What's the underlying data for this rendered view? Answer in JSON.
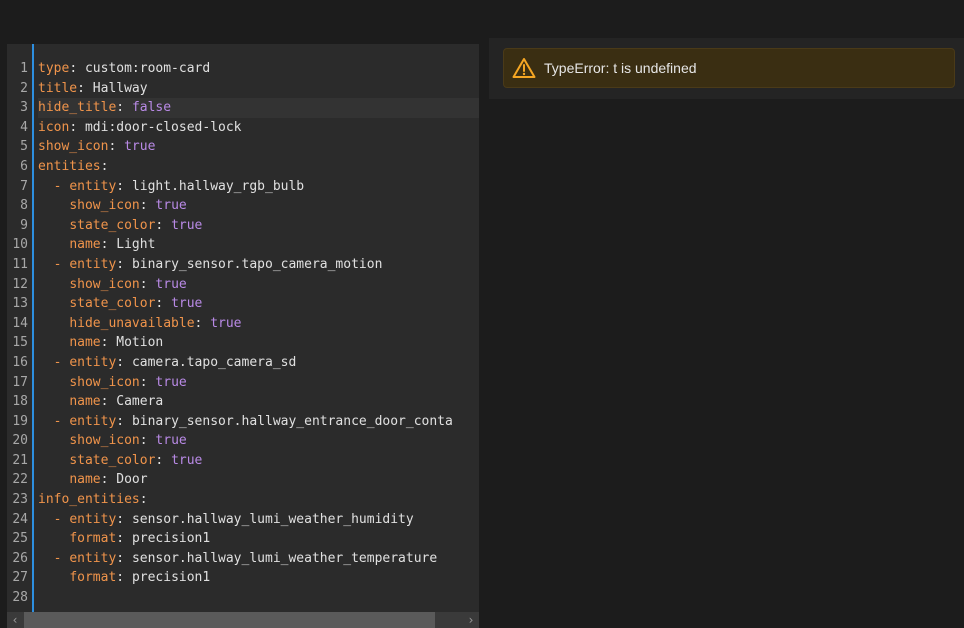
{
  "colors": {
    "accent": "#2d8fe0",
    "key": "#f0944b",
    "boolean": "#b98ae6",
    "warning": "#f5a623"
  },
  "editor": {
    "lines": [
      {
        "num": "1",
        "key": "type",
        "value": "custom:room-card"
      },
      {
        "num": "2",
        "key": "title",
        "value": "Hallway"
      },
      {
        "num": "3",
        "key": "hide_title",
        "value": "false",
        "bool": true,
        "active": true
      },
      {
        "num": "4",
        "key": "icon",
        "value": "mdi:door-closed-lock"
      },
      {
        "num": "5",
        "key": "show_icon",
        "value": "true",
        "bool": true
      },
      {
        "num": "6",
        "key": "entities",
        "value": ""
      },
      {
        "num": "7",
        "indent": "  ",
        "dash": true,
        "key": "entity",
        "value": "light.hallway_rgb_bulb"
      },
      {
        "num": "8",
        "indent": "    ",
        "key": "show_icon",
        "value": "true",
        "bool": true
      },
      {
        "num": "9",
        "indent": "    ",
        "key": "state_color",
        "value": "true",
        "bool": true
      },
      {
        "num": "10",
        "indent": "    ",
        "key": "name",
        "value": "Light"
      },
      {
        "num": "11",
        "indent": "  ",
        "dash": true,
        "key": "entity",
        "value": "binary_sensor.tapo_camera_motion"
      },
      {
        "num": "12",
        "indent": "    ",
        "key": "show_icon",
        "value": "true",
        "bool": true
      },
      {
        "num": "13",
        "indent": "    ",
        "key": "state_color",
        "value": "true",
        "bool": true
      },
      {
        "num": "14",
        "indent": "    ",
        "key": "hide_unavailable",
        "value": "true",
        "bool": true
      },
      {
        "num": "15",
        "indent": "    ",
        "key": "name",
        "value": "Motion"
      },
      {
        "num": "16",
        "indent": "  ",
        "dash": true,
        "key": "entity",
        "value": "camera.tapo_camera_sd"
      },
      {
        "num": "17",
        "indent": "    ",
        "key": "show_icon",
        "value": "true",
        "bool": true
      },
      {
        "num": "18",
        "indent": "    ",
        "key": "name",
        "value": "Camera"
      },
      {
        "num": "19",
        "indent": "  ",
        "dash": true,
        "key": "entity",
        "value": "binary_sensor.hallway_entrance_door_conta"
      },
      {
        "num": "20",
        "indent": "    ",
        "key": "show_icon",
        "value": "true",
        "bool": true
      },
      {
        "num": "21",
        "indent": "    ",
        "key": "state_color",
        "value": "true",
        "bool": true
      },
      {
        "num": "22",
        "indent": "    ",
        "key": "name",
        "value": "Door"
      },
      {
        "num": "23",
        "key": "info_entities",
        "value": ""
      },
      {
        "num": "24",
        "indent": "  ",
        "dash": true,
        "key": "entity",
        "value": "sensor.hallway_lumi_weather_humidity"
      },
      {
        "num": "25",
        "indent": "    ",
        "key": "format",
        "value": "precision1"
      },
      {
        "num": "26",
        "indent": "  ",
        "dash": true,
        "key": "entity",
        "value": "sensor.hallway_lumi_weather_temperature"
      },
      {
        "num": "27",
        "indent": "    ",
        "key": "format",
        "value": "precision1"
      },
      {
        "num": "28",
        "key": "",
        "value": ""
      }
    ],
    "scroll_left_icon": "chevron-left-icon",
    "scroll_right_icon": "chevron-right-icon"
  },
  "preview": {
    "error_message": "TypeError: t is undefined",
    "warning_icon": "alert-triangle-icon"
  }
}
